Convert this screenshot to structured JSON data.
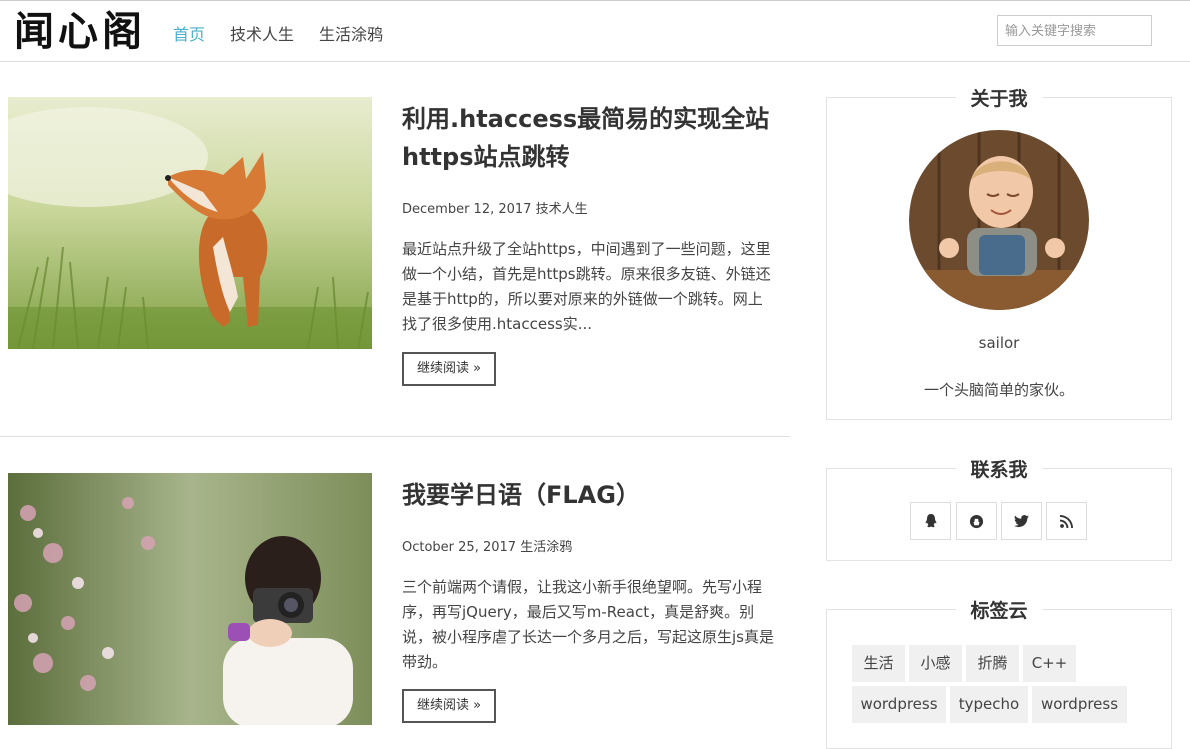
{
  "site": {
    "logo_text": "闻心阁",
    "nav": [
      {
        "label": "首页",
        "active": true
      },
      {
        "label": "技术人生",
        "active": false
      },
      {
        "label": "生活涂鸦",
        "active": false
      }
    ],
    "search_placeholder": "输入关键字搜索"
  },
  "posts": [
    {
      "title": "利用.htaccess最简易的实现全站https站点跳转",
      "date": "December 12, 2017",
      "category": "技术人生",
      "excerpt": "最近站点升级了全站https，中间遇到了一些问题，这里做一个小结，首先是https跳转。原来很多友链、外链还是基于http的，所以要对原来的外链做一个跳转。网上找了很多使用.htaccess实...",
      "read_more": "继续阅读 »"
    },
    {
      "title": "我要学日语（FLAG）",
      "date": "October 25, 2017",
      "category": "生活涂鸦",
      "excerpt": "三个前端两个请假，让我这小新手很绝望啊。先写小程序，再写jQuery，最后又写m-React，真是舒爽。别说，被小程序虐了长达一个多月之后，写起这原生js真是带劲。",
      "read_more": "继续阅读 »"
    }
  ],
  "sidebar": {
    "about": {
      "title": "关于我",
      "name": "sailor",
      "bio": "一个头脑简单的家伙。"
    },
    "contact": {
      "title": "联系我",
      "icons": [
        "qq-icon",
        "github-icon",
        "twitter-icon",
        "rss-icon"
      ]
    },
    "tags": {
      "title": "标签云",
      "items": [
        "生活",
        "小感",
        "折腾",
        "C++",
        "wordpress",
        "typecho",
        "wordpress"
      ]
    }
  }
}
